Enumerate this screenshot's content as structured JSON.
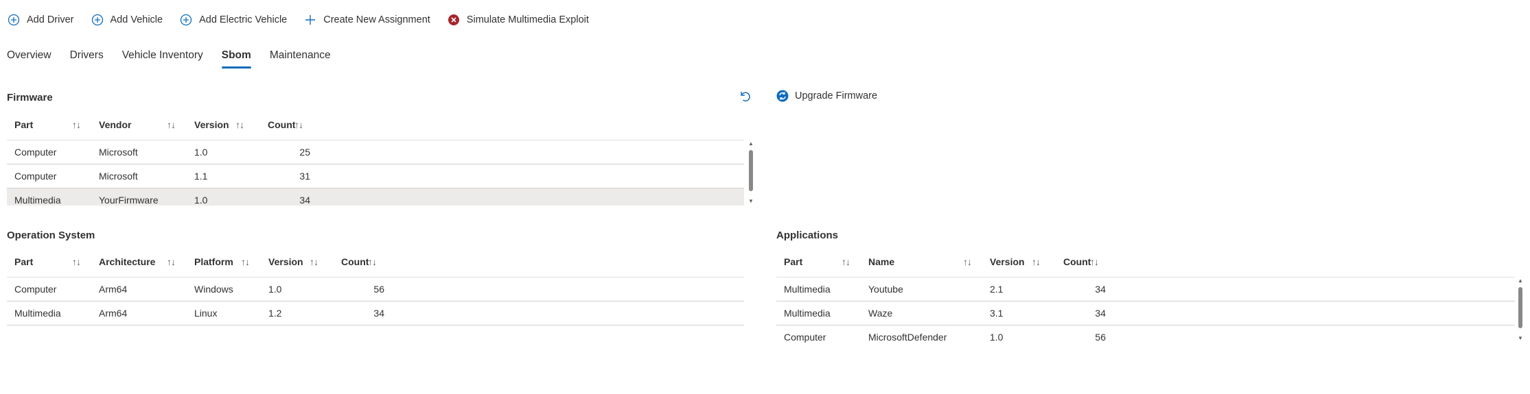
{
  "commands": [
    {
      "label": "Add Driver",
      "icon": "add-circle-icon"
    },
    {
      "label": "Add Vehicle",
      "icon": "add-circle-icon"
    },
    {
      "label": "Add Electric Vehicle",
      "icon": "add-circle-icon"
    },
    {
      "label": "Create New Assignment",
      "icon": "plus-icon"
    },
    {
      "label": "Simulate Multimedia Exploit",
      "icon": "error-circle-icon"
    }
  ],
  "tabs": [
    {
      "label": "Overview"
    },
    {
      "label": "Drivers"
    },
    {
      "label": "Vehicle Inventory"
    },
    {
      "label": "Sbom",
      "active": true
    },
    {
      "label": "Maintenance"
    }
  ],
  "colors": {
    "accent": "#0f6cbd",
    "danger": "#a4262c",
    "selected_row": "#edebe9"
  },
  "firmware": {
    "title": "Firmware",
    "refresh_icon": "undo-icon",
    "upgrade_label": "Upgrade Firmware",
    "upgrade_icon": "sync-circle-icon",
    "columns": [
      "Part",
      "Vendor",
      "Version",
      "Count"
    ],
    "rows": [
      [
        "Computer",
        "Microsoft",
        "1.0",
        "25"
      ],
      [
        "Computer",
        "Microsoft",
        "1.1",
        "31"
      ],
      [
        "Multimedia",
        "YourFirmware",
        "1.0",
        "34"
      ]
    ]
  },
  "os": {
    "title": "Operation System",
    "columns": [
      "Part",
      "Architecture",
      "Platform",
      "Version",
      "Count"
    ],
    "rows": [
      [
        "Computer",
        "Arm64",
        "Windows",
        "1.0",
        "56"
      ],
      [
        "Multimedia",
        "Arm64",
        "Linux",
        "1.2",
        "34"
      ]
    ]
  },
  "apps": {
    "title": "Applications",
    "columns": [
      "Part",
      "Name",
      "Version",
      "Count"
    ],
    "rows": [
      [
        "Multimedia",
        "Youtube",
        "2.1",
        "34"
      ],
      [
        "Multimedia",
        "Waze",
        "3.1",
        "34"
      ],
      [
        "Computer",
        "MicrosoftDefender",
        "1.0",
        "56"
      ]
    ]
  },
  "sort_glyph": "↑↓"
}
